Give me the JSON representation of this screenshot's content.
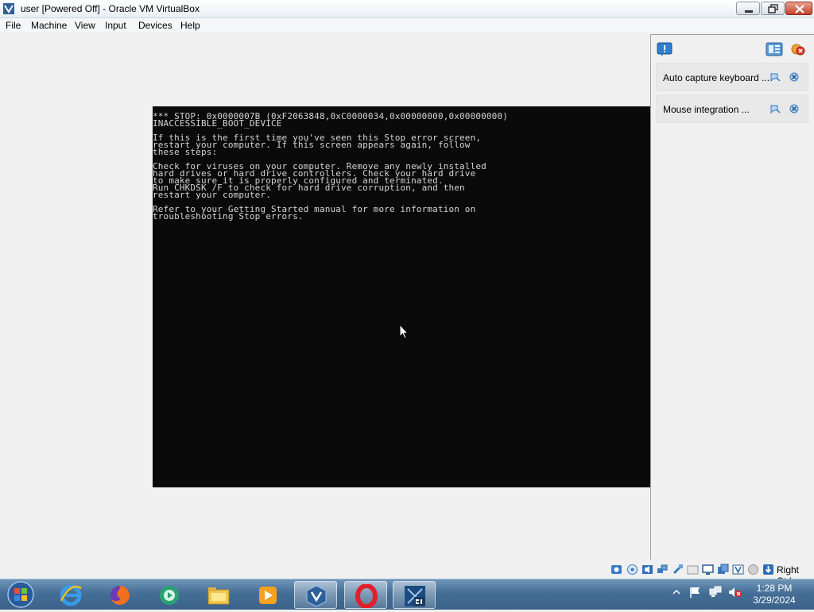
{
  "window": {
    "title": "user [Powered Off] - Oracle VM VirtualBox"
  },
  "menu": [
    "File",
    "Machine",
    "View",
    "Input",
    "Devices",
    "Help"
  ],
  "vm_screen": {
    "lines": [
      "*** STOP: 0x0000007B (0xF2063848,0xC0000034,0x00000000,0x00000000)",
      "INACCESSIBLE_BOOT_DEVICE",
      "",
      "If this is the first time you've seen this Stop error screen,",
      "restart your computer. If this screen appears again, follow",
      "these steps:",
      "",
      "Check for viruses on your computer. Remove any newly installed",
      "hard drives or hard drive controllers. Check your hard drive",
      "to make sure it is properly configured and terminated.",
      "Run CHKDSK /F to check for hard drive corruption, and then",
      "restart your computer.",
      "",
      "Refer to your Getting Started manual for more information on",
      "troubleshooting Stop errors."
    ]
  },
  "notifications": [
    {
      "text": "Auto capture keyboard ..."
    },
    {
      "text": "Mouse integration ..."
    }
  ],
  "statusbar": {
    "host_key": "Right Ctrl",
    "icons": [
      "hard-disk-icon",
      "optical-drive-icon",
      "audio-icon",
      "network-icon",
      "usb-icon",
      "shared-folders-icon",
      "display-icon",
      "video-capture-icon",
      "recording-icon",
      "cpu-icon",
      "mouse-integration-icon",
      "keyboard-capture-icon"
    ]
  },
  "taskbar": {
    "apps": [
      "internet-explorer",
      "firefox",
      "media-center",
      "file-explorer",
      "media-player",
      "virtualbox",
      "opera",
      "windows-8-1-vm"
    ],
    "clock_time": "1:28 PM",
    "clock_date": "3/29/2024"
  },
  "colors": {
    "bsod_bg": "#0a0a0a",
    "bsod_text": "#d4d4d4",
    "taskbar": "#456e96"
  }
}
